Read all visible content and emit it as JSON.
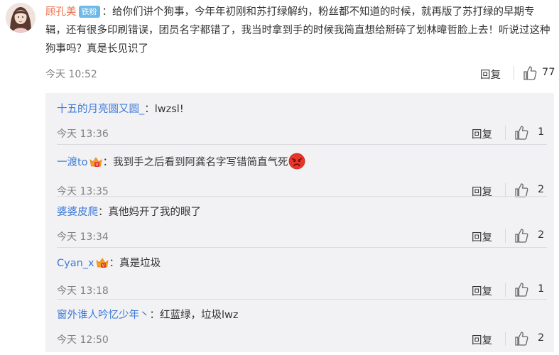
{
  "main_comment": {
    "username": "顾孔美",
    "badge": "铁粉",
    "text": "：给你们讲个狗事，今年年初刚和苏打绿解约，粉丝都不知道的时候，就再版了苏打绿的早期专辑，还有很多印刷错误，团员名字都错了，我当时拿到手的时候我简直想给掰碎了划林暐哲脸上去！听说过这种狗事吗？真是长见识了",
    "time": "今天 10:52",
    "reply_label": "回复",
    "likes": "77"
  },
  "replies": [
    {
      "username": "十五的月亮圆又圆_",
      "vip": false,
      "text": "：lwzsl!",
      "emoji": false,
      "time": "今天 13:36",
      "reply_label": "回复",
      "likes": "1"
    },
    {
      "username": "一渡to",
      "vip": true,
      "text": "：我到手之后看到阿龚名字写错简直气死",
      "emoji": true,
      "time": "今天 13:35",
      "reply_label": "回复",
      "likes": "2"
    },
    {
      "username": "婆婆皮爬",
      "vip": false,
      "text": "：真他妈开了我的眼了",
      "emoji": false,
      "time": "今天 13:34",
      "reply_label": "回复",
      "likes": "2"
    },
    {
      "username": "Cyan_x",
      "vip": true,
      "text": "：真是垃圾",
      "emoji": false,
      "time": "今天 13:18",
      "reply_label": "回复",
      "likes": "1"
    },
    {
      "username": "窗外谁人吟忆少年丶",
      "vip": false,
      "text": "：红蓝绿，垃圾lwz",
      "emoji": false,
      "time": "今天 12:50",
      "reply_label": "回复",
      "likes": "2"
    }
  ],
  "colors": {
    "username_main": "#eb7350",
    "username_reply": "#3d7ad6",
    "badge_bg": "#6fb9e8",
    "reply_panel_bg": "#f2f2f5"
  },
  "icons": {
    "like": "thumbs-up-icon",
    "vip": "vip-crown-icon",
    "emoji": "angry-face-icon"
  }
}
